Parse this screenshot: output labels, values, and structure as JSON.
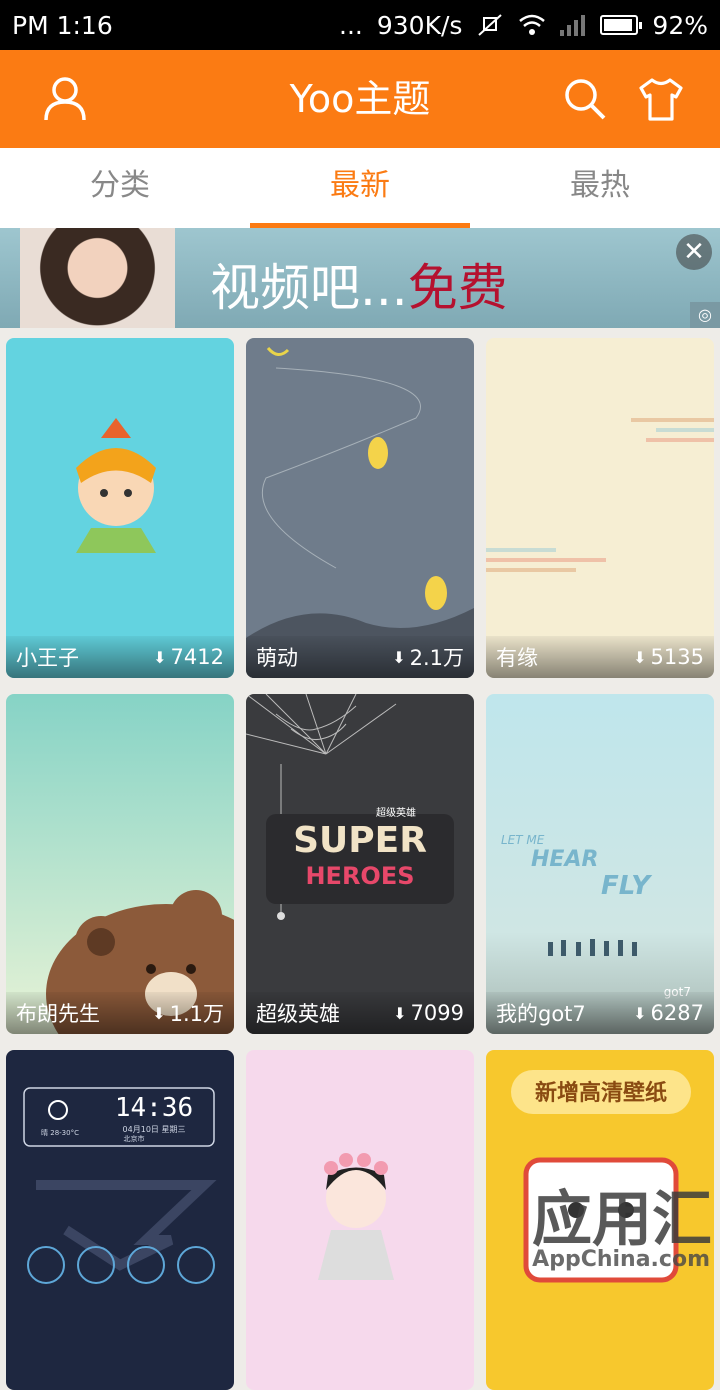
{
  "status": {
    "time": "PM 1:16",
    "dots": "...",
    "speed": "930K/s",
    "battery": "92%",
    "battery_level": 0.92
  },
  "header": {
    "title": "Yoo主题"
  },
  "tabs": [
    {
      "label": "分类"
    },
    {
      "label": "最新"
    },
    {
      "label": "最热"
    }
  ],
  "banner": {
    "text_main": "视频吧...",
    "text_accent": "免费"
  },
  "themes": [
    {
      "name": "小王子",
      "downloads": "7412"
    },
    {
      "name": "萌动",
      "downloads": "2.1万"
    },
    {
      "name": "有缘",
      "downloads": "5135"
    },
    {
      "name": "布朗先生",
      "downloads": "1.1万"
    },
    {
      "name": "超级英雄",
      "downloads": "7099"
    },
    {
      "name": "我的got7",
      "downloads": "6287"
    },
    {
      "name": "",
      "downloads": ""
    },
    {
      "name": "",
      "downloads": ""
    },
    {
      "name": "",
      "downloads": ""
    }
  ],
  "thumb_text": {
    "super": "SUPER",
    "heroes": "HEROES",
    "super_cn": "超级英雄",
    "clock": "14:36",
    "clock_date": "04月10日 星期三",
    "clock_weather": "晴 28-30°C",
    "clock_city": "北京市",
    "hd_banner": "新增高清壁纸",
    "got7_line1": "LET ME",
    "got7_line2": "HEAR",
    "got7_line3": "FLY",
    "got7_sig": "got7"
  },
  "watermark": {
    "main": "应用汇",
    "sub": "AppChina.com"
  },
  "colors": {
    "accent": "#fb7b13"
  }
}
